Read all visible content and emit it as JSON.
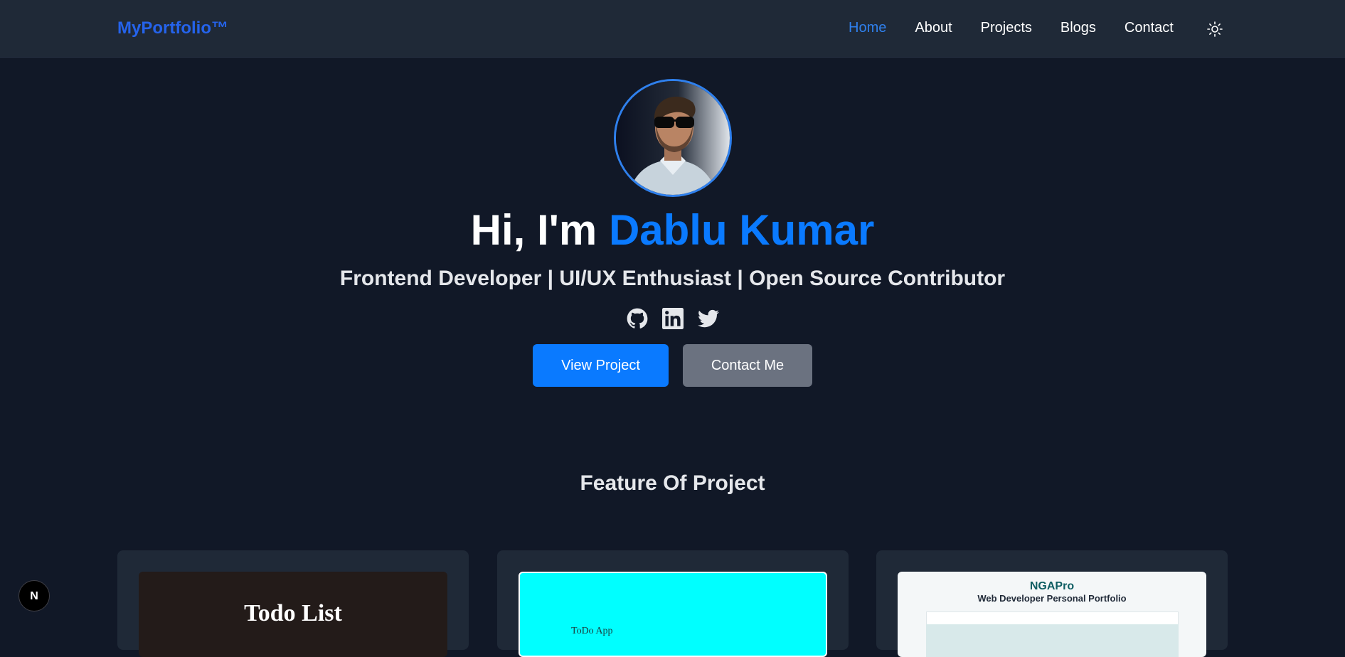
{
  "nav": {
    "brand": "MyPortfolio™",
    "links": [
      {
        "label": "Home",
        "active": true
      },
      {
        "label": "About",
        "active": false
      },
      {
        "label": "Projects",
        "active": false
      },
      {
        "label": "Blogs",
        "active": false
      },
      {
        "label": "Contact",
        "active": false
      }
    ],
    "theme_icon": "sun-icon"
  },
  "hero": {
    "greeting": "Hi, I'm ",
    "name": "Dablu Kumar",
    "subtitle": "Frontend Developer | UI/UX Enthusiast | Open Source Contributor",
    "social_icons": [
      "github-icon",
      "linkedin-icon",
      "twitter-icon"
    ],
    "primary_cta": "View Project",
    "secondary_cta": "Contact Me"
  },
  "projects": {
    "section_title": "Feature Of Project",
    "cards": [
      {
        "thumb_title": "Todo List"
      },
      {
        "thumb_title": "ToDo App"
      },
      {
        "thumb_logo": "NGAPro",
        "thumb_subtitle": "Web Developer Personal Portfolio"
      }
    ]
  },
  "dev_badge": {
    "label": "N"
  },
  "colors": {
    "background": "#111827",
    "navbar": "#1f2937",
    "accent": "#0a7aff",
    "brand": "#2563eb",
    "secondary_button": "#6b7280",
    "card": "#1f2937"
  }
}
